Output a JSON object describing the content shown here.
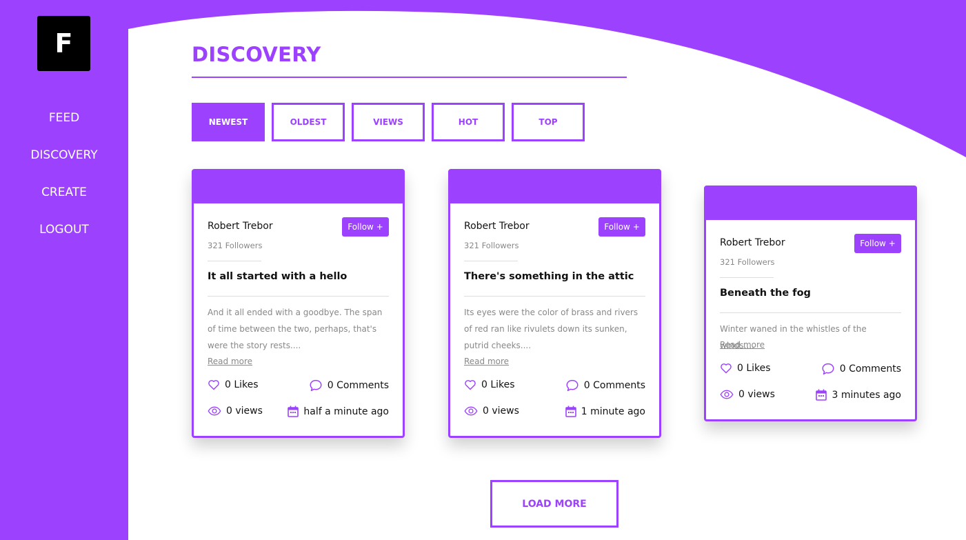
{
  "logo": {
    "letter": "F"
  },
  "nav": [
    {
      "label": "FEED"
    },
    {
      "label": "DISCOVERY"
    },
    {
      "label": "CREATE"
    },
    {
      "label": "LOGOUT"
    }
  ],
  "page_title": "DISCOVERY",
  "tabs": [
    {
      "label": "NEWEST",
      "active": true
    },
    {
      "label": "OLDEST",
      "active": false
    },
    {
      "label": "VIEWS",
      "active": false
    },
    {
      "label": "HOT",
      "active": false
    },
    {
      "label": "TOP",
      "active": false
    }
  ],
  "posts": [
    {
      "author": "Robert Trebor",
      "followers": "321 Followers",
      "follow_label": "Follow +",
      "title": "It all started with a hello",
      "excerpt": "And it all ended with a goodbye. The span of time between the two, perhaps, that's were the story rests....",
      "read_more": "Read more",
      "likes": "0 Likes",
      "comments": "0 Comments",
      "views": "0 views",
      "time": "half a minute ago"
    },
    {
      "author": "Robert Trebor",
      "followers": "321 Followers",
      "follow_label": "Follow +",
      "title": "There's something in the attic",
      "excerpt": "Its eyes were the color of brass and rivers of red ran like rivulets down its sunken, putrid cheeks....",
      "read_more": "Read more",
      "likes": "0 Likes",
      "comments": "0 Comments",
      "views": "0 views",
      "time": "1 minute ago"
    },
    {
      "author": "Robert Trebor",
      "followers": "321 Followers",
      "follow_label": "Follow +",
      "title": "Beneath the fog",
      "excerpt": "Winter waned in the whistles of the winds....",
      "read_more": "Read more",
      "likes": "0 Likes",
      "comments": "0 Comments",
      "views": "0 views",
      "time": "3 minutes ago"
    }
  ],
  "load_more": "LOAD MORE",
  "colors": {
    "accent": "#9c42ff",
    "logo_bg": "#000000",
    "muted_text": "#888888"
  },
  "icons": {
    "like": "heart-icon",
    "comment": "comment-icon",
    "views": "eye-icon",
    "time": "calendar-icon"
  }
}
